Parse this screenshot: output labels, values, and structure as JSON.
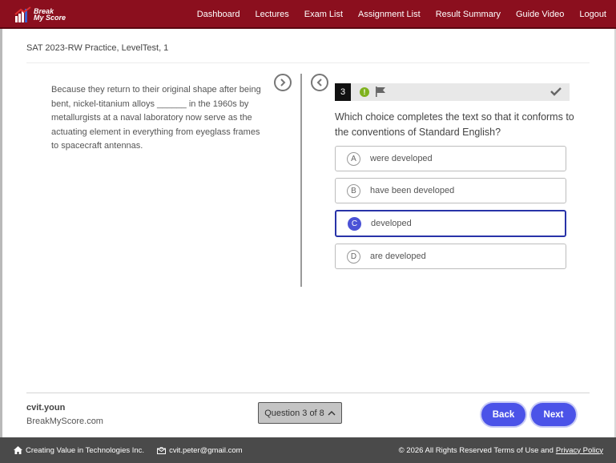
{
  "header": {
    "logo_line1": "Break",
    "logo_line2": "My Score",
    "nav": [
      "Dashboard",
      "Lectures",
      "Exam List",
      "Assignment List",
      "Result Summary",
      "Guide Video",
      "Logout"
    ]
  },
  "test_title": "SAT 2023-RW Practice, LevelTest, 1",
  "passage": "Because they return to their original shape after being bent, nickel-titanium alloys ______ in the 1960s by metallurgists at a naval laboratory now serve as the actuating element in everything from eyeglass frames to spacecraft antennas.",
  "question": {
    "number": "3",
    "text": "Which choice completes the text so that it conforms to the conventions of Standard English?",
    "choices": [
      {
        "letter": "A",
        "text": "were developed"
      },
      {
        "letter": "B",
        "text": "have been developed"
      },
      {
        "letter": "C",
        "text": "developed"
      },
      {
        "letter": "D",
        "text": "are developed"
      }
    ],
    "selected": "C"
  },
  "user": {
    "name": "cvit.youn",
    "site": "BreakMyScore.com"
  },
  "navigation": {
    "question_counter": "Question 3 of 8",
    "back_label": "Back",
    "next_label": "Next"
  },
  "footer": {
    "company": "Creating Value in Technologies Inc.",
    "email": "cvit.peter@gmail.com",
    "copyright": "© 2026 All Rights Reserved Terms of Use and",
    "privacy": "Privacy Policy"
  },
  "colors": {
    "header_bg": "#8b0f1e",
    "accent_blue": "#4b53e8",
    "selected_border": "#2833a8",
    "warn_green": "#7fb21e"
  }
}
